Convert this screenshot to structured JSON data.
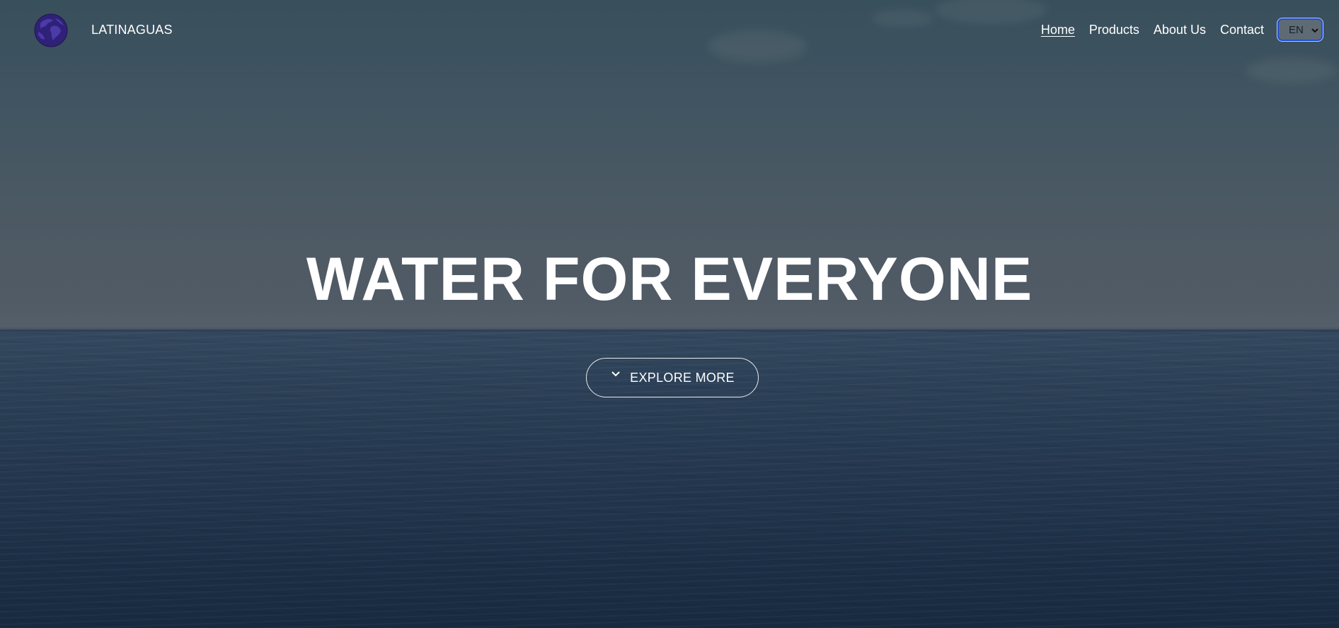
{
  "brand": {
    "name": "LATINAGUAS",
    "logo_icon": "globe-icon"
  },
  "nav": {
    "items": [
      {
        "label": "Home",
        "active": true
      },
      {
        "label": "Products",
        "active": false
      },
      {
        "label": "About Us",
        "active": false
      },
      {
        "label": "Contact",
        "active": false
      }
    ],
    "language": {
      "selected": "EN"
    }
  },
  "hero": {
    "headline": "WATER FOR EVERYONE",
    "button_label": "EXPLORE MORE",
    "button_icon": "chevron-down-icon"
  },
  "colors": {
    "text": "#ffffff",
    "select_border": "#1f4fd6",
    "logo": "#3a2a8a"
  }
}
